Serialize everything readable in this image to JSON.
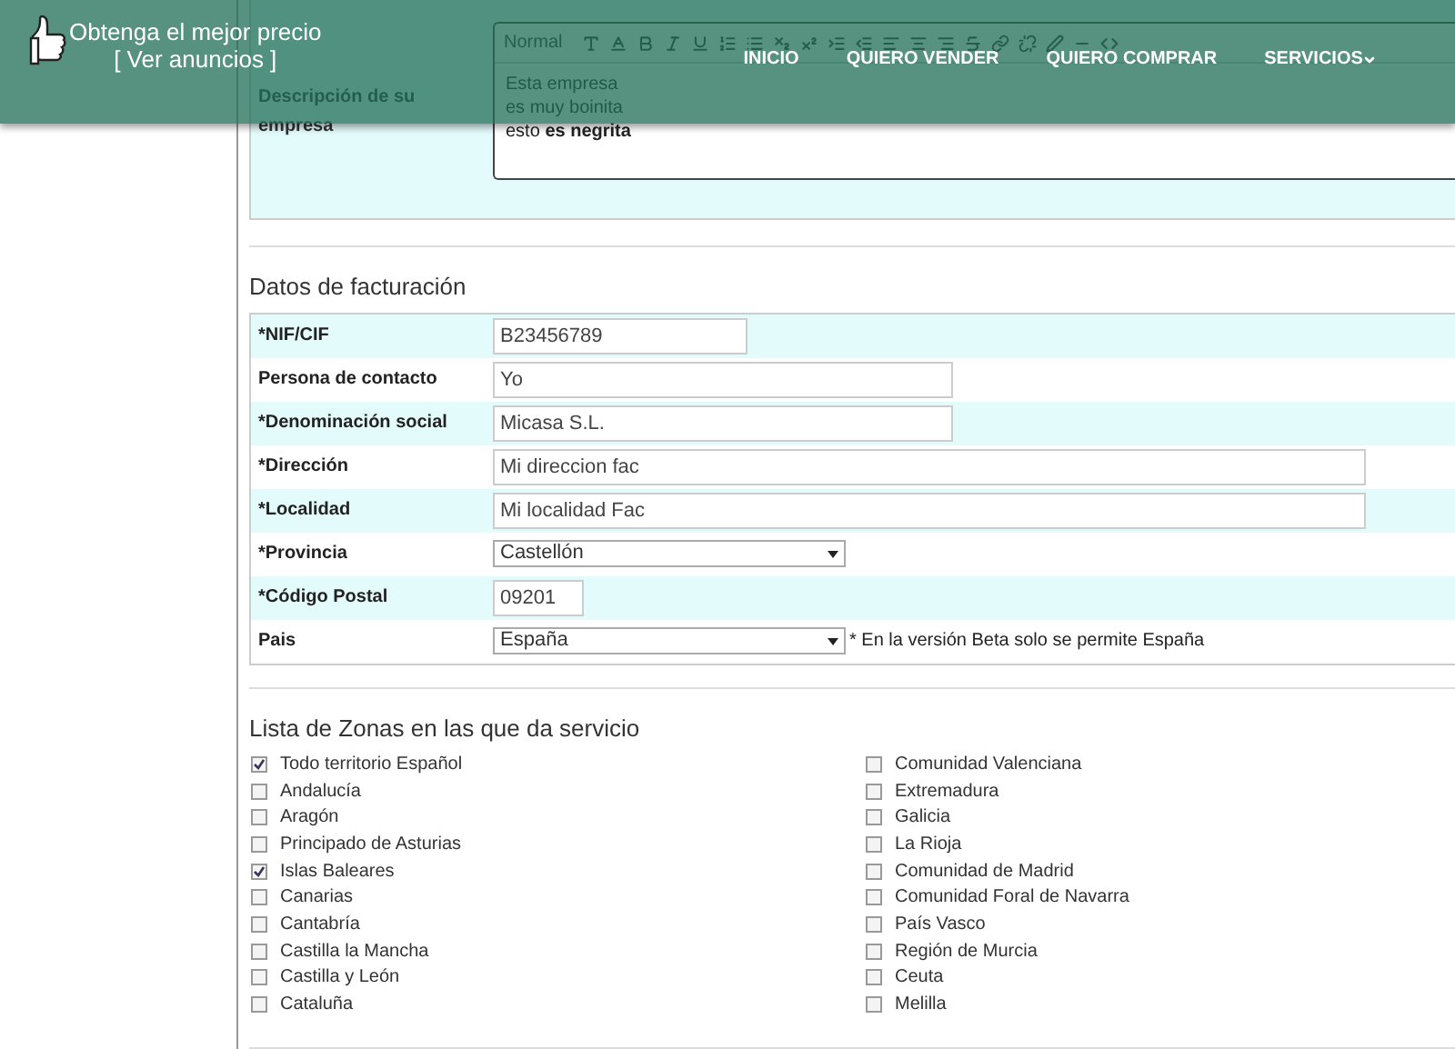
{
  "header": {
    "brand_line1": "Obtenga el mejor precio",
    "brand_line2": "[ Ver anuncios ]",
    "nav": [
      {
        "label": "INICIO",
        "kind": "link"
      },
      {
        "label": "QUIERO VENDER",
        "kind": "link"
      },
      {
        "label": "QUIERO COMPRAR",
        "kind": "link"
      },
      {
        "label": "SERVICIOS",
        "kind": "dropdown"
      }
    ]
  },
  "description": {
    "label": "Descripción de su empresa",
    "toolbar": {
      "format": "Normal"
    },
    "lines": [
      "Esta empresa",
      "es muy boinita",
      "esto **es negrita**"
    ]
  },
  "billing": {
    "title": "Datos de facturación",
    "rows": [
      {
        "label": "*NIF/CIF",
        "value": "B23456789",
        "kind": "text"
      },
      {
        "label": "Persona de contacto",
        "value": "Yo",
        "kind": "text"
      },
      {
        "label": "*Denominación social",
        "value": "Micasa S.L.",
        "kind": "text"
      },
      {
        "label": "*Dirección",
        "value": "Mi direccion fac",
        "kind": "text"
      },
      {
        "label": "*Localidad",
        "value": "Mi localidad Fac",
        "kind": "text"
      },
      {
        "label": "*Provincia",
        "value": "Castellón",
        "kind": "select"
      },
      {
        "label": "*Código Postal",
        "value": "09201",
        "kind": "text"
      },
      {
        "label": "Pais",
        "value": "España",
        "kind": "select",
        "note": "* En la versión Beta solo se permite España"
      }
    ]
  },
  "zones": {
    "title": "Lista de Zonas en las que da servicio",
    "columns": [
      [
        {
          "label": "Todo territorio Español",
          "checked": true
        },
        {
          "label": "Andalucía",
          "checked": false
        },
        {
          "label": "Aragón",
          "checked": false
        },
        {
          "label": "Principado de Asturias",
          "checked": false
        },
        {
          "label": "Islas Baleares",
          "checked": true
        },
        {
          "label": "Canarias",
          "checked": false
        },
        {
          "label": "Cantabría",
          "checked": false
        },
        {
          "label": "Castilla la Mancha",
          "checked": false
        },
        {
          "label": "Castilla y León",
          "checked": false
        },
        {
          "label": "Cataluña",
          "checked": false
        }
      ],
      [
        {
          "label": "Comunidad Valenciana",
          "checked": false
        },
        {
          "label": "Extremadura",
          "checked": false
        },
        {
          "label": "Galicia",
          "checked": false
        },
        {
          "label": "La Rioja",
          "checked": false
        },
        {
          "label": "Comunidad de Madrid",
          "checked": false
        },
        {
          "label": "Comunidad Foral de Navarra",
          "checked": false
        },
        {
          "label": "País Vasco",
          "checked": false
        },
        {
          "label": "Región de Murcia",
          "checked": false
        },
        {
          "label": "Ceuta",
          "checked": false
        },
        {
          "label": "Melilla",
          "checked": false
        }
      ]
    ]
  }
}
